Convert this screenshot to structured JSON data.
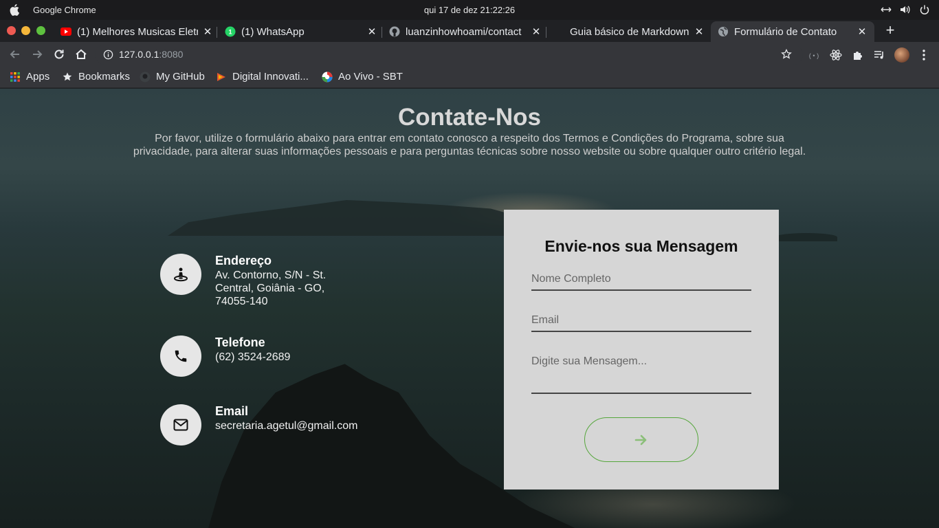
{
  "os": {
    "app_name": "Google Chrome",
    "clock": "qui 17 de dez  21:22:26"
  },
  "tabs": [
    {
      "title": "(1) Melhores Musicas Eletr",
      "icon": "youtube-icon"
    },
    {
      "title": "(1) WhatsApp",
      "icon": "whatsapp-icon"
    },
    {
      "title": "luanzinhowhoami/contact",
      "icon": "github-icon"
    },
    {
      "title": "Guia básico de Markdown",
      "icon": ""
    },
    {
      "title": "Formulário de Contato",
      "icon": "globe-icon",
      "active": true
    }
  ],
  "address_bar": {
    "host": "127.0.0.1",
    "port": ":8080"
  },
  "bookmarks": [
    {
      "label": "Apps",
      "icon": "apps-grid-icon"
    },
    {
      "label": "Bookmarks",
      "icon": "star-icon"
    },
    {
      "label": "My GitHub",
      "icon": "github-icon"
    },
    {
      "label": "Digital Innovati...",
      "icon": "dio-icon"
    },
    {
      "label": "Ao Vivo - SBT",
      "icon": "sbt-icon"
    }
  ],
  "page": {
    "title": "Contate-Nos",
    "subtitle": "Por favor, utilize o formulário abaixo para entrar em contato conosco a respeito dos Termos e Condições do Programa, sobre sua privacidade, para alterar suas informações pessoais e para perguntas técnicas sobre nosso website ou sobre qualquer outro critério legal.",
    "contact_info": [
      {
        "label": "Endereço",
        "value": "Av. Contorno, S/N - St. Central, Goiânia - GO, 74055-140",
        "icon": "location-pin-icon"
      },
      {
        "label": "Telefone",
        "value": "(62) 3524-2689",
        "icon": "phone-icon"
      },
      {
        "label": "Email",
        "value": "secretaria.agetul@gmail.com",
        "icon": "envelope-icon"
      }
    ],
    "form": {
      "title": "Envie-nos sua Mensagem",
      "name_placeholder": "Nome Completo",
      "email_placeholder": "Email",
      "message_placeholder": "Digite sua Mensagem...",
      "send_icon": "arrow-right-icon"
    }
  },
  "colors": {
    "accent_green": "#55a63b",
    "form_background": "#d6d6d6"
  }
}
